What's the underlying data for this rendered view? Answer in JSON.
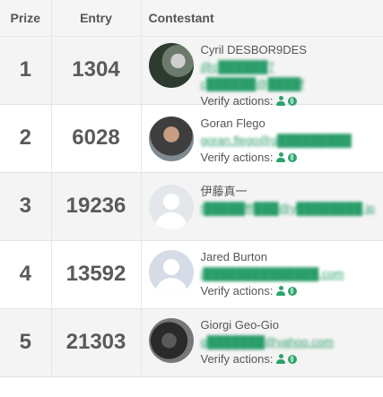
{
  "headers": {
    "prize": "Prize",
    "entry": "Entry",
    "contestant": "Contestant"
  },
  "verify_label": "Verify actions:",
  "rows": [
    {
      "prize": "1",
      "entry": "1304",
      "name": "Cyril DESBOR9DES",
      "lines": [
        "@c██████7",
        "c██████@████f"
      ]
    },
    {
      "prize": "2",
      "entry": "6028",
      "name": "Goran Flego",
      "lines": [
        "goran.flego@g█████████"
      ]
    },
    {
      "prize": "3",
      "entry": "19236",
      "name": "伊藤真一",
      "lines": [
        "t█████ffl███@y████████.jp"
      ]
    },
    {
      "prize": "4",
      "entry": "13592",
      "name": "Jared Burton",
      "lines": [
        "j██████████████.com"
      ]
    },
    {
      "prize": "5",
      "entry": "21303",
      "name": "Giorgi Geo-Gio",
      "lines": [
        "g███████@yahoo.com"
      ]
    }
  ],
  "icons": {
    "user": "user-icon",
    "globe": "globe-icon"
  },
  "colors": {
    "link": "#2a9d6a",
    "icon": "#2aa36b",
    "odd_row": "#f4f4f4"
  }
}
